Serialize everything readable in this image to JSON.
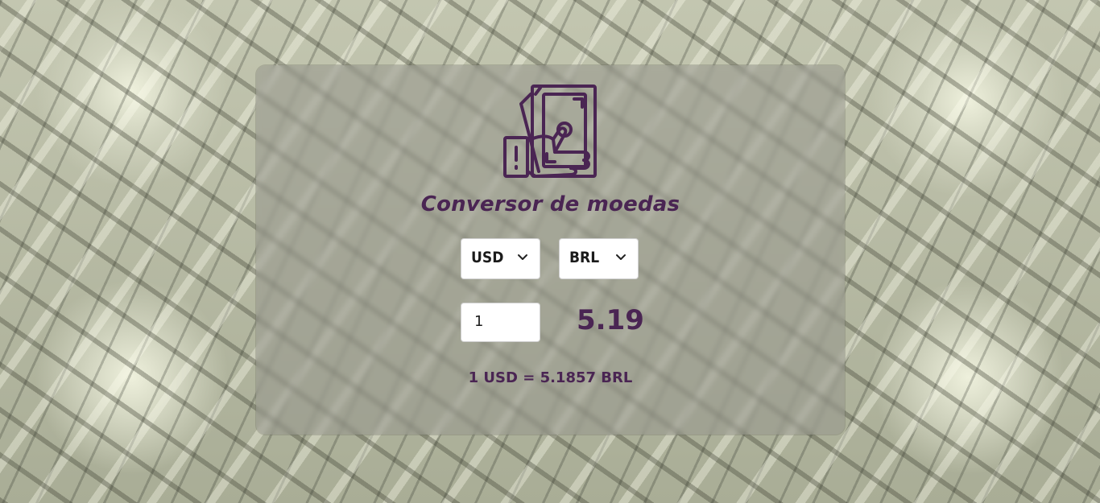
{
  "app": {
    "title": "Conversor de moedas",
    "logo_icon": "money-hand-icon",
    "accent_color": "#4a2553"
  },
  "converter": {
    "from_currency": "USD",
    "to_currency": "BRL",
    "amount": "1",
    "result": "5.19",
    "rate_text": "1 USD = 5.1857 BRL"
  }
}
